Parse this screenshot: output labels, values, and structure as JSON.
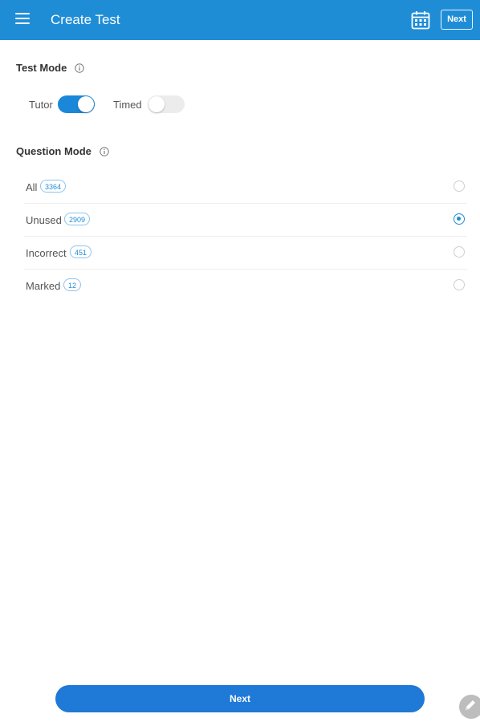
{
  "app_bar": {
    "title": "Create Test",
    "next_label": "Next",
    "accent_color": "#1f8dd6"
  },
  "test_mode": {
    "title": "Test Mode",
    "options": [
      {
        "label": "Tutor",
        "on": true
      },
      {
        "label": "Timed",
        "on": false
      }
    ]
  },
  "question_mode": {
    "title": "Question Mode",
    "options": [
      {
        "label": "All",
        "count": "3364",
        "selected": false
      },
      {
        "label": "Unused",
        "count": "2909",
        "selected": true
      },
      {
        "label": "Incorrect",
        "count": "451",
        "selected": false
      },
      {
        "label": "Marked",
        "count": "12",
        "selected": false
      }
    ]
  },
  "footer": {
    "next_label": "Next"
  },
  "icons": [
    "menu-icon",
    "calendar-icon",
    "info-icon",
    "edit-icon"
  ]
}
